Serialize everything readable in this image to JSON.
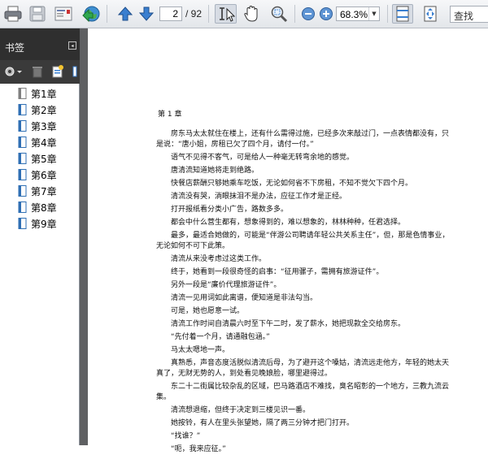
{
  "toolbar": {
    "page_current": "2",
    "page_total": "/ 92",
    "zoom_value": "68.3%",
    "search_placeholder": "查找",
    "icons": [
      "print-icon",
      "save-icon",
      "email-icon",
      "internet-icon",
      "previous-page-icon",
      "next-page-icon",
      "select-tool-icon",
      "hand-tool-icon",
      "marquee-zoom-icon",
      "zoom-out-icon",
      "zoom-in-icon",
      "fit-page-icon",
      "fit-width-icon"
    ]
  },
  "panel": {
    "title": "书签",
    "bookmarks": [
      {
        "label": "第1章",
        "selected": true
      },
      {
        "label": "第2章"
      },
      {
        "label": "第3章"
      },
      {
        "label": "第4章"
      },
      {
        "label": "第5章"
      },
      {
        "label": "第6章"
      },
      {
        "label": "第7章"
      },
      {
        "label": "第8章"
      },
      {
        "label": "第9章"
      }
    ]
  },
  "document": {
    "heading": "第 1 章",
    "paragraphs": [
      [
        "　　房东马太太就住在楼上，还有什么需得过施，已经多次来敲过门，一点表情都没有，只",
        "是说：“唐小姐，房租已欠了四个月，请付一付。”"
      ],
      [
        "　　语气不见得不客气，可是给人一种毫无转弯余地的感觉。"
      ],
      [
        "　　唐清流知道她将走到绝路。"
      ],
      [
        "　　快餐店薪酬只够她乘车吃饭，无论如何省不下房租，不知不觉欠下四个月。"
      ],
      [
        "　　清流没有哭，淌眼抹泪不是办法，应征工作才是正经。"
      ],
      [
        "　　打开报纸看分类小广告，路数多多。"
      ],
      [
        "　　都会中什么营生都有，想象得到的，难以想象的，林林种种，任君选择。"
      ],
      [
        "　　最多，最适合她做的，可能是“伴游公司聘请年轻公共关系主任”，但，那是色情事业，",
        "无论如何不可下此策。"
      ],
      [
        "　　清流从来没考虑过这类工作。"
      ],
      [
        "　　终于，她看到一段很奇怪的启事：“征用骡子，需拥有旅游证件”。"
      ],
      [
        "　　另外一段是“廉价代理旅游证件”。"
      ],
      [
        "　　清流一见用词如此离谱，便知道是非法勾当。"
      ],
      [
        "　　可是，她也愿意一试。"
      ],
      [
        "　　清流工作时间自清晨六时至下午二时，发了薪水，她把现款全交给房东。"
      ],
      [
        "　　“先付着一个月，请通融包涵。”"
      ],
      [
        "　　马太太嗯地一声。"
      ],
      [
        "　　真熟悉，声音态度活脱似清流后母，为了避开这个嗓姑，清流远走他方，年轻的她太天",
        "真了，无财无势的人，到处看见晚娘脸，哪里避得过。"
      ],
      [
        "　　东二十二街属比较杂乱的区域，巴马路酒店不难找，臭名昭彰的一个地方，三教九流云",
        "集。"
      ],
      [
        "　　清流想退缩，但终于决定到三楼见识一番。"
      ],
      [
        "　　她按铃，有人在里头张望她，隔了两三分钟才把门打开。"
      ],
      [
        "　　“找谁？”"
      ],
      [
        "　　“呃，我来应征。”"
      ]
    ]
  }
}
